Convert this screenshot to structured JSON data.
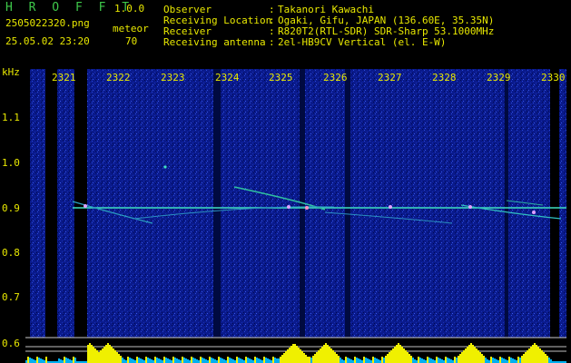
{
  "header": {
    "brand": "H R O F F T",
    "version": "1.0.0",
    "filename": "2505022320.png",
    "datetime": "25.05.02 23:20",
    "meteor_label": "meteor",
    "meteor_count": "70"
  },
  "info": [
    {
      "label": "Observer",
      "value": "Takanori Kawachi"
    },
    {
      "label": "Receiving Location",
      "value": "Ogaki, Gifu, JAPAN (136.60E, 35.35N)"
    },
    {
      "label": "Receiver",
      "value": "R820T2(RTL-SDR) SDR-Sharp 53.1000MHz"
    },
    {
      "label": "Receiving antenna",
      "value": "2el-HB9CV Vertical (el. E-W)"
    }
  ],
  "separator": ":",
  "axis": {
    "unit": "kHz",
    "y_ticks": [
      "1.1",
      "1.0",
      "0.9",
      "0.8",
      "0.7",
      "0.6"
    ],
    "x_ticks": [
      "2321",
      "2322",
      "2323",
      "2324",
      "2325",
      "2326",
      "2327",
      "2328",
      "2329",
      "2330"
    ]
  },
  "colors": {
    "background": "#000000",
    "spectrogram": "#0a1a8c",
    "text": "#e8e800",
    "brand": "#3ec84a",
    "signal_line": "#40e0c0",
    "level": "#f0f000",
    "level_floor": "#00b0f0"
  }
}
